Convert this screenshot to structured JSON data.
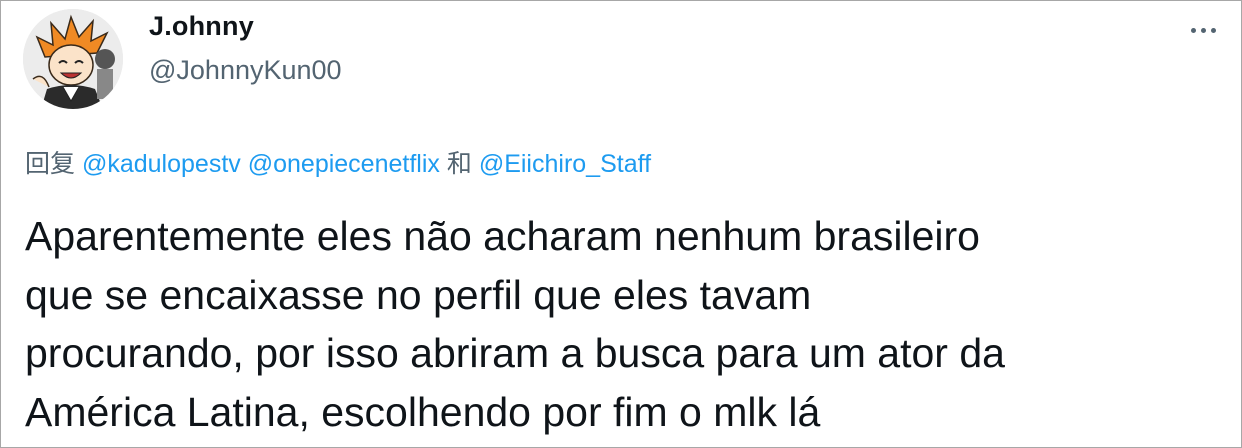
{
  "author": {
    "display_name": "J.ohnny",
    "handle": "@JohnnyKun00",
    "avatar_icon": "user-avatar-anime-character"
  },
  "menu": {
    "icon": "more-options-icon"
  },
  "reply": {
    "prefix": "回复",
    "mentions": [
      "@kadulopestv",
      "@onepiecenetflix",
      "@Eiichiro_Staff"
    ],
    "joiner": "和"
  },
  "tweet": {
    "lines": [
      "Aparentemente eles não acharam nenhum brasileiro",
      "que se encaixasse no perfil que eles tavam",
      "procurando, por isso abriram a busca para um ator da",
      "América Latina, escolhendo por fim o mlk lá"
    ]
  },
  "colors": {
    "link": "#1d9bf0",
    "secondary_text": "#536471",
    "primary_text": "#0f1419"
  }
}
